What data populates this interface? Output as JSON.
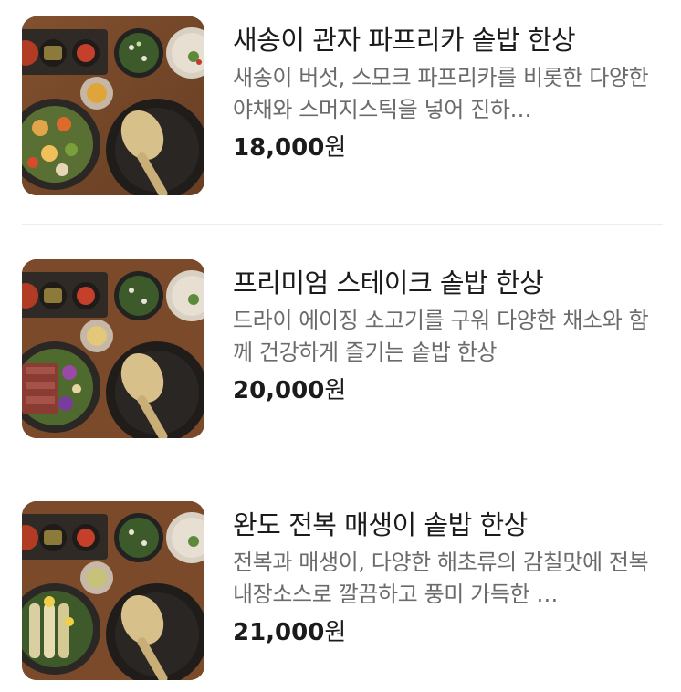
{
  "menu": {
    "items": [
      {
        "title": "새송이 관자 파프리카 솥밥 한상",
        "description": "새송이 버섯, 스모크 파프리카를 비롯한 다양한 야채와 스머지스틱을 넣어 진하…",
        "price_number": "18,000",
        "price_unit": "원",
        "image_icon": "food-photo-icon"
      },
      {
        "title": "프리미엄 스테이크 솥밥 한상",
        "description": "드라이 에이징 소고기를 구워 다양한 채소와 함께 건강하게 즐기는 솥밥 한상",
        "price_number": "20,000",
        "price_unit": "원",
        "image_icon": "food-photo-icon"
      },
      {
        "title": "완도 전복 매생이 솥밥 한상",
        "description": "전복과 매생이, 다양한 해초류의 감칠맛에 전복내장소스로 깔끔하고 풍미 가득한 …",
        "price_number": "21,000",
        "price_unit": "원",
        "image_icon": "food-photo-icon"
      }
    ]
  },
  "colors": {
    "title": "#1b1b1b",
    "description": "#6b6b6b",
    "divider": "#ececec",
    "table_wood": "#6b4226"
  }
}
